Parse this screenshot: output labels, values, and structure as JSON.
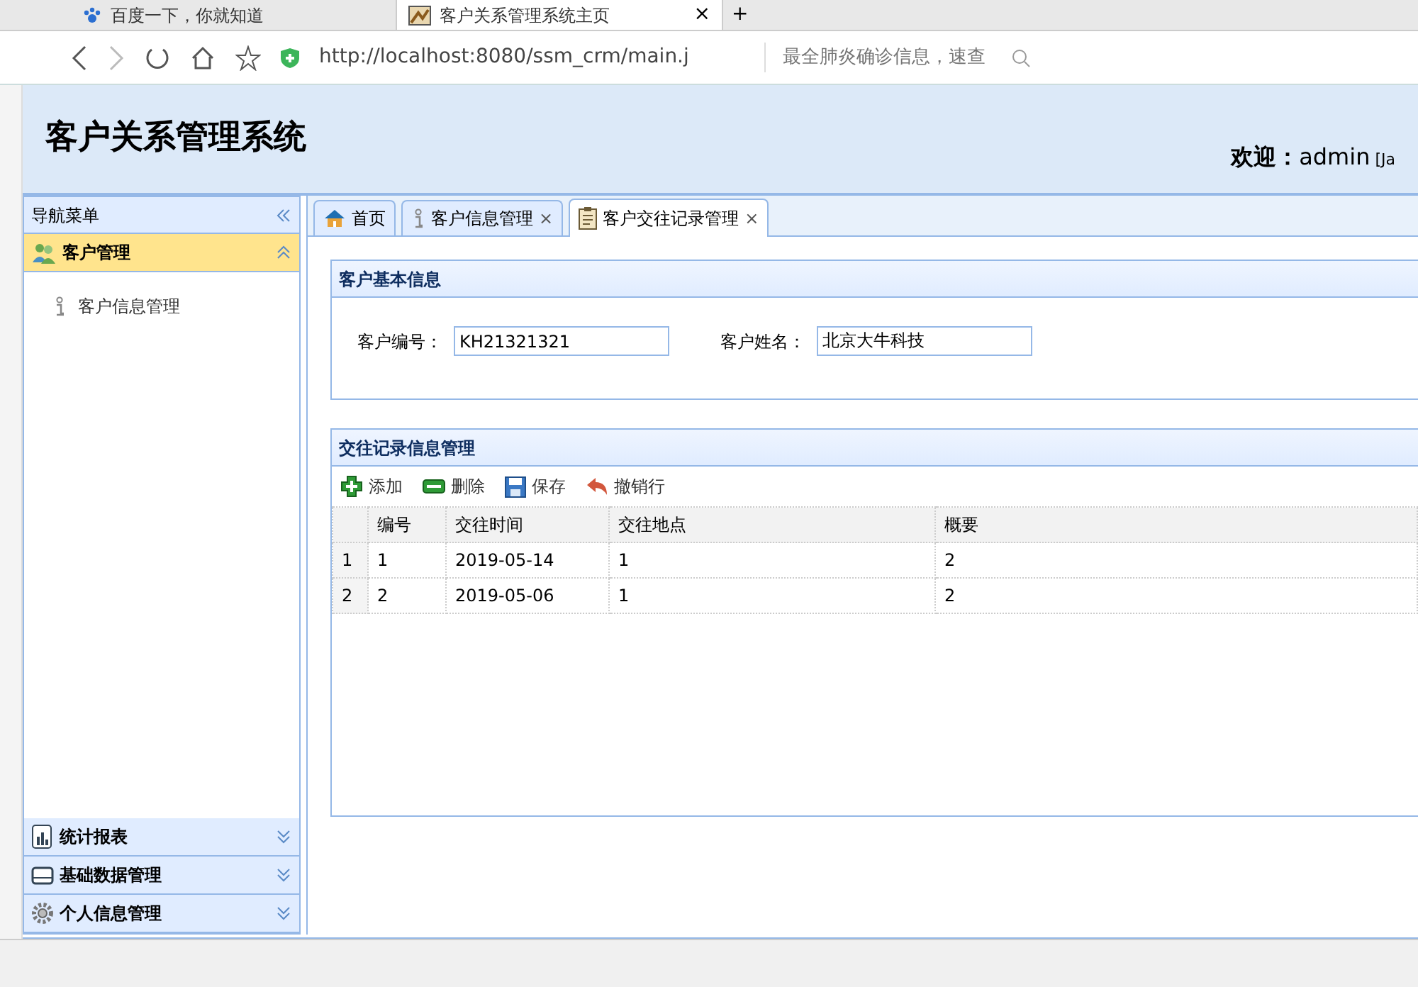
{
  "browser": {
    "tabs": [
      {
        "title": "百度一下，你就知道",
        "selected": false,
        "kind": "paw"
      },
      {
        "title": "客户关系管理系统主页",
        "selected": true,
        "kind": "page",
        "close": "×"
      }
    ],
    "new_tab": "+",
    "url": "http://localhost:8080/ssm_crm/main.j",
    "search": {
      "placeholder": "最全肺炎确诊信息，速查"
    }
  },
  "app": {
    "title": "客户关系管理系统",
    "welcome": {
      "label": "欢迎：",
      "user": "admin",
      "extra": "[Ja"
    },
    "nav": {
      "title": "导航菜单",
      "sections": [
        {
          "label": "客户管理",
          "kind": "users",
          "expanded": true,
          "children": [
            {
              "label": "客户信息管理"
            }
          ]
        },
        {
          "label": "统计报表",
          "kind": "chart",
          "expanded": false
        },
        {
          "label": "基础数据管理",
          "kind": "drive",
          "expanded": false
        },
        {
          "label": "个人信息管理",
          "kind": "gear",
          "expanded": false
        }
      ]
    },
    "tabs": [
      {
        "label": "首页",
        "kind": "home",
        "selected": false
      },
      {
        "label": "客户信息管理",
        "kind": "info",
        "selected": false,
        "close": "×"
      },
      {
        "label": "客户交往记录管理",
        "kind": "clipboard",
        "selected": true,
        "close": "×"
      }
    ],
    "customer_panel": {
      "title": "客户基本信息",
      "fields": [
        {
          "label": "客户编号：",
          "value": "KH21321321"
        },
        {
          "label": "客户姓名：",
          "value": "北京大牛科技"
        }
      ]
    },
    "records_panel": {
      "title": "交往记录信息管理",
      "toolbar": [
        {
          "label": "添加",
          "kind": "add"
        },
        {
          "label": "删除",
          "kind": "remove"
        },
        {
          "label": "保存",
          "kind": "save"
        },
        {
          "label": "撤销行",
          "kind": "undo"
        }
      ],
      "columns": [
        "编号",
        "交往时间",
        "交往地点",
        "概要"
      ],
      "rows": [
        {
          "row_number": "1",
          "cells": [
            "1",
            "2019-05-14",
            "1",
            "2"
          ]
        },
        {
          "row_number": "2",
          "cells": [
            "2",
            "2019-05-06",
            "1",
            "2"
          ]
        }
      ]
    }
  }
}
